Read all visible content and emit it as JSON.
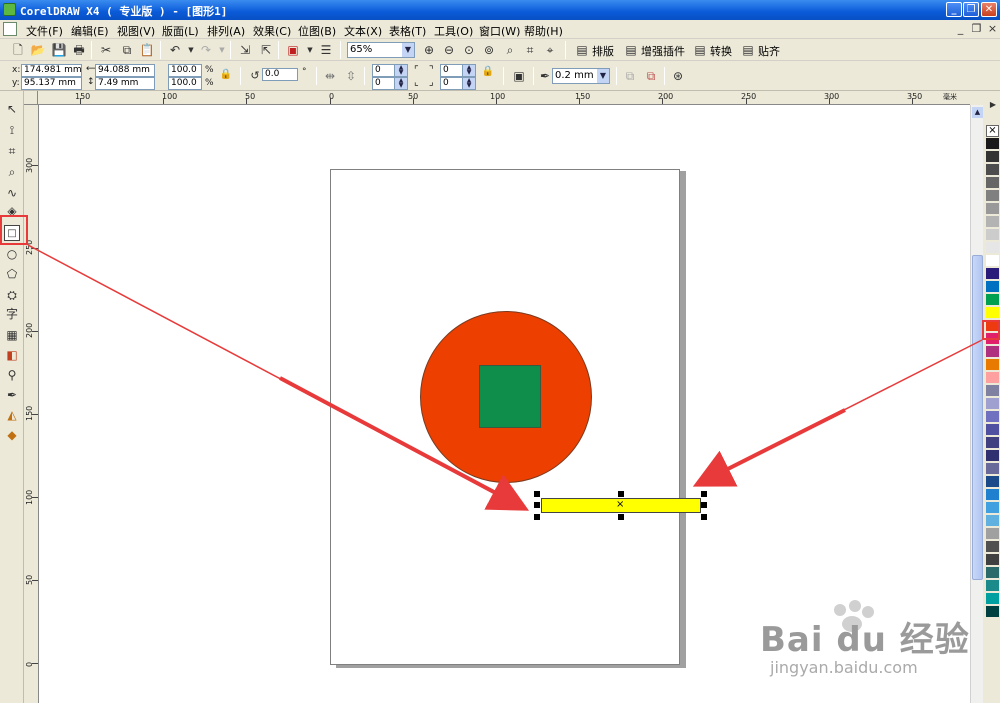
{
  "window": {
    "title": "CorelDRAW X4 ( 专业版 ) - [图形1]",
    "minimize": "_",
    "restore": "❐",
    "close": "✕"
  },
  "menu": [
    "文件(F)",
    "编辑(E)",
    "视图(V)",
    "版面(L)",
    "排列(A)",
    "效果(C)",
    "位图(B)",
    "文本(X)",
    "表格(T)",
    "工具(O)",
    "窗口(W)",
    "帮助(H)"
  ],
  "mdi_controls": [
    "_",
    "❐",
    "×"
  ],
  "toolbar": {
    "zoom_value": "65%",
    "arrange_label": "排版",
    "enhance_label": "增强插件",
    "convert_label": "转换",
    "snap_label": "贴齐"
  },
  "property_bar": {
    "x_label": "x:",
    "y_label": "y:",
    "x_value": "174.981 mm",
    "y_value": "95.137 mm",
    "width_value": "94.088 mm",
    "height_value": "7.49 mm",
    "scale_x": "100.0",
    "scale_y": "100.0",
    "percent": "%",
    "rotation": "0.0",
    "degree": "°",
    "corner_1": "0",
    "corner_2": "0",
    "corner_3": "0",
    "corner_4": "0",
    "outline_width": "0.2 mm"
  },
  "ruler_top": {
    "labels": [
      "150",
      "100",
      "50",
      "0",
      "50",
      "100",
      "150",
      "200",
      "250",
      "300",
      "350"
    ],
    "unit": "毫米"
  },
  "ruler_left": {
    "labels": [
      "300",
      "250",
      "200",
      "150",
      "100",
      "50",
      "0"
    ]
  },
  "shapes": {
    "circle_color": "#ec3f00",
    "square_color": "#0f8d4a",
    "rect_color": "#ffff00"
  },
  "palette": {
    "colors": [
      "#1a1a1a",
      "#333333",
      "#4d4d4d",
      "#666666",
      "#808080",
      "#999999",
      "#b3b3b3",
      "#cccccc",
      "#e6e6e6",
      "#ffffff",
      "#2a1a7a",
      "#0070c0",
      "#00a050",
      "#ffff00",
      "#ee3a10",
      "#e0206a",
      "#b03080",
      "#e87a00",
      "#ffa0a0",
      "#8080a0",
      "#a0a0d0",
      "#7070c0",
      "#5050a0",
      "#404080",
      "#303070",
      "#6a6a9a",
      "#1a4a8a",
      "#2080d0",
      "#40a0e0",
      "#60b0e0",
      "#a0a0a0",
      "#505050",
      "#404040",
      "#2a6a6a",
      "#1a8a8a",
      "#00a0a0",
      "#004040"
    ],
    "selected_index": 13,
    "no_fill": "⨯"
  },
  "watermark": {
    "text": "Bai du 经验",
    "url": "jingyan.baidu.com"
  }
}
